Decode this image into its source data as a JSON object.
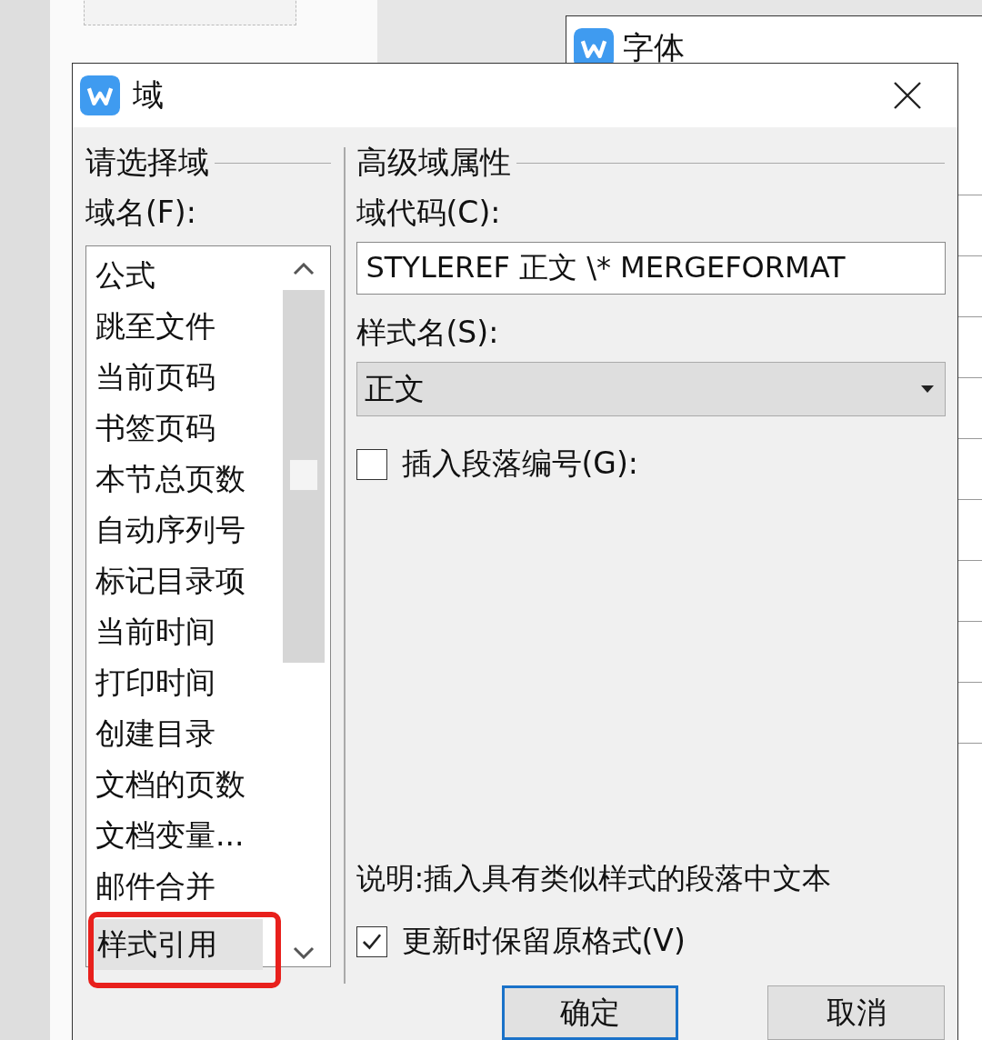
{
  "background_window": {
    "title": "字体"
  },
  "dialog": {
    "title": "域"
  },
  "field_section": {
    "heading": "请选择域",
    "label": "域名(F):",
    "items": [
      {
        "label": "公式",
        "selected": false
      },
      {
        "label": "跳至文件",
        "selected": false
      },
      {
        "label": "当前页码",
        "selected": false
      },
      {
        "label": "书签页码",
        "selected": false
      },
      {
        "label": "本节总页数",
        "selected": false
      },
      {
        "label": "自动序列号",
        "selected": false
      },
      {
        "label": "标记目录项",
        "selected": false
      },
      {
        "label": "当前时间",
        "selected": false
      },
      {
        "label": "打印时间",
        "selected": false
      },
      {
        "label": "创建目录",
        "selected": false
      },
      {
        "label": "文档的页数",
        "selected": false
      },
      {
        "label": "文档变量...",
        "selected": false
      },
      {
        "label": "邮件合并",
        "selected": false
      },
      {
        "label": "样式引用",
        "selected": true
      }
    ]
  },
  "properties": {
    "heading": "高级域属性",
    "field_code": {
      "label": "域代码(C):",
      "value": "STYLEREF 正文 \\* MERGEFORMAT"
    },
    "style_name": {
      "label": "样式名(S):",
      "value": "正文"
    },
    "options": [
      {
        "label": "插入段落编号(G):",
        "checked": false
      }
    ],
    "description": "说明:插入具有类似样式的段落中文本",
    "preserve": {
      "label": "更新时保留原格式(V)",
      "checked": true
    }
  },
  "buttons": [
    {
      "label": "确定",
      "default": true
    },
    {
      "label": "取消",
      "default": false
    }
  ]
}
